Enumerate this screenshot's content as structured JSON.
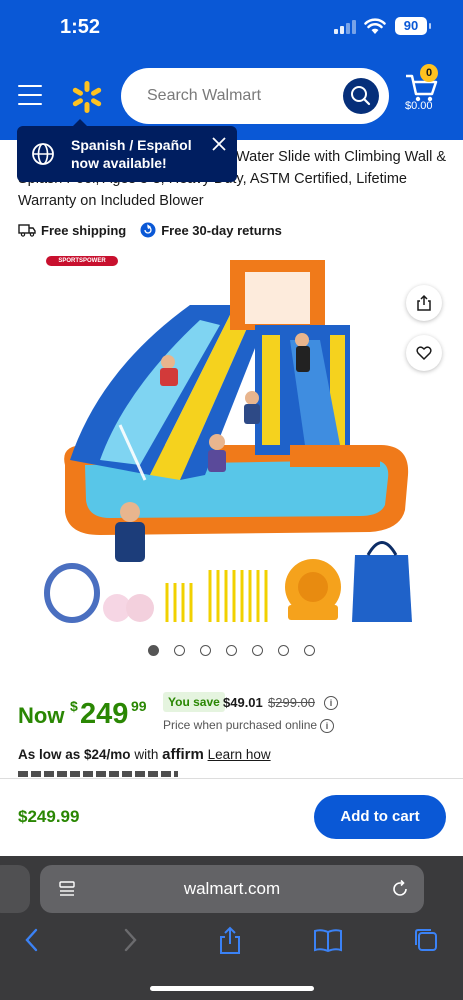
{
  "status": {
    "time": "1:52",
    "battery": "90"
  },
  "header": {
    "search_placeholder": "Search Walmart",
    "cart_count": "0",
    "cart_amount": "$0.00",
    "brand_color": "#0a58d6",
    "spark_color": "#ffc220"
  },
  "tooltip": {
    "text_line1": "Spanish / Español",
    "text_line2": "now available!"
  },
  "product": {
    "title": "Water Slide with Climbing Wall & Splash Pool, Ages 3-8, Heavy Duty, ASTM Certified, Lifetime Warranty on Included Blower",
    "free_shipping": "Free shipping",
    "free_returns": "Free 30-day returns",
    "brand_logo": "SPORTSPOWER",
    "image_icon": "inflatable-water-slide-image",
    "image_count": 7,
    "image_active": 1
  },
  "pricing": {
    "now_label": "Now",
    "currency": "$",
    "price_whole": "249",
    "price_cents": "99",
    "you_save_label": "You save",
    "save_amount": "$49.01",
    "was_price": "$299.00",
    "note": "Price when purchased online",
    "as_low_as": "As low as $24/mo",
    "with": "with",
    "affirm": "affirm",
    "learn_how": "Learn how",
    "price_color": "#2a8703"
  },
  "bottom_bar": {
    "price": "$249.99",
    "add_to_cart": "Add to cart"
  },
  "browser": {
    "url": "walmart.com"
  }
}
